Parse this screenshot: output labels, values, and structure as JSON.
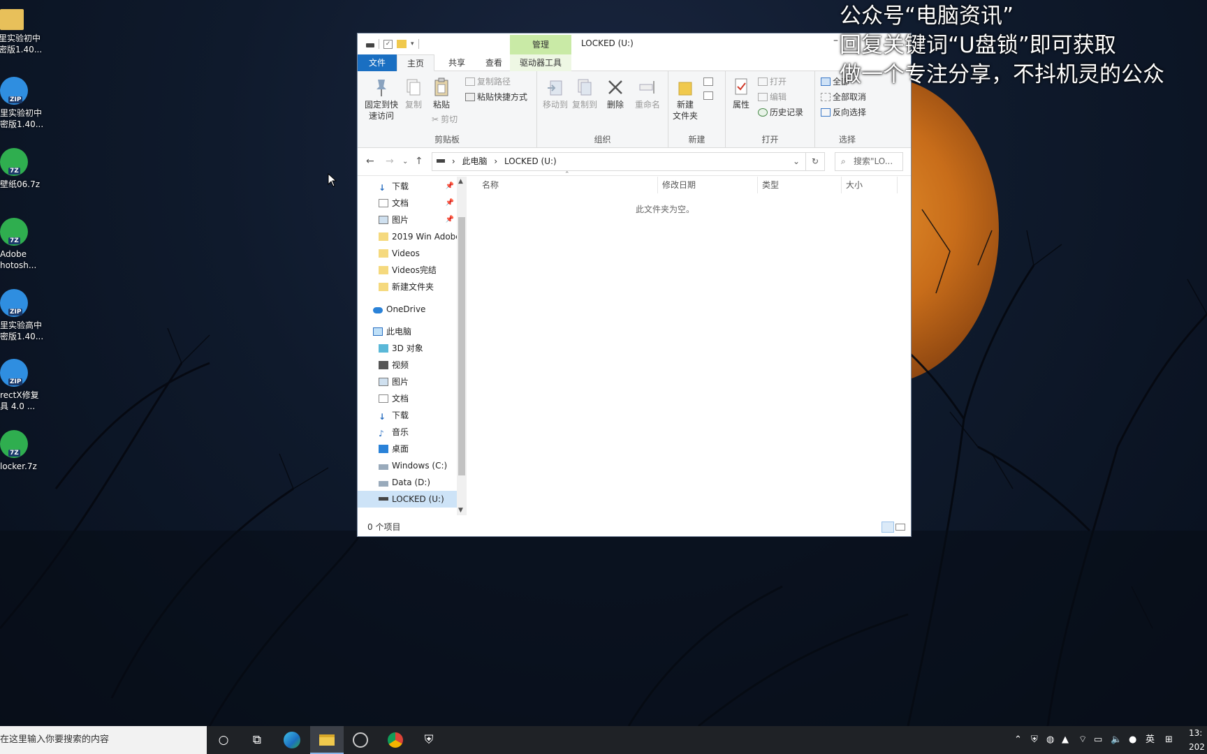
{
  "overlay": {
    "line1": "公众号“电脑资讯”",
    "line2": "回复关键词“U盘锁”即可获取",
    "line3": "做一个专注分享，不抖机灵的公众"
  },
  "desktop_icons": [
    {
      "label1": "里实验初中",
      "label2": "密版1.40...",
      "icon": "folder-icon"
    },
    {
      "label1": "里实验初中",
      "label2": "密版1.40...",
      "icon": "zip-archive-icon",
      "badge": "ZIP"
    },
    {
      "label1": "壁纸06.7z",
      "label2": "",
      "icon": "7z-archive-icon",
      "badge": "7Z"
    },
    {
      "label1": "Adobe",
      "label2": "hotosh...",
      "icon": "7z-archive-icon",
      "badge": "7Z"
    },
    {
      "label1": "里实验高中",
      "label2": "密版1.40...",
      "icon": "zip-archive-icon",
      "badge": "ZIP"
    },
    {
      "label1": "rectX修复",
      "label2": "具 4.0 ...",
      "icon": "zip-archive-icon",
      "badge": "ZIP"
    },
    {
      "label1": "locker.7z",
      "label2": "",
      "icon": "7z-archive-icon",
      "badge": "7Z"
    }
  ],
  "explorer": {
    "title": "LOCKED (U:)",
    "manage_tab": "管理",
    "tabs": {
      "file": "文件",
      "home": "主页",
      "share": "共享",
      "view": "查看",
      "drive_tools": "驱动器工具"
    },
    "ribbon": {
      "clipboard": {
        "name": "剪贴板",
        "pin": "固定到快",
        "pin2": "速访问",
        "copy": "复制",
        "paste": "粘贴",
        "copy_path": "复制路径",
        "paste_shortcut": "粘贴快捷方式",
        "cut": "剪切"
      },
      "organize": {
        "name": "组织",
        "move_to": "移动到",
        "copy_to": "复制到",
        "delete": "删除",
        "rename": "重命名"
      },
      "new": {
        "name": "新建",
        "new_folder": "新建",
        "new_folder2": "文件夹"
      },
      "open": {
        "name": "打开",
        "properties": "属性",
        "open": "打开",
        "edit": "编辑",
        "history": "历史记录"
      },
      "select": {
        "name": "选择",
        "select_all": "全部",
        "select_none": "全部取消",
        "invert": "反向选择"
      }
    },
    "address": {
      "crumb1": "此电脑",
      "crumb2": "LOCKED (U:)",
      "search_placeholder": "搜索\"LO..."
    },
    "nav": [
      {
        "label": "下载",
        "icon": "download-icon",
        "pinned": true
      },
      {
        "label": "文档",
        "icon": "document-icon",
        "pinned": true
      },
      {
        "label": "图片",
        "icon": "pictures-icon",
        "pinned": true
      },
      {
        "label": "2019 Win Adobe",
        "icon": "folder-icon"
      },
      {
        "label": "Videos",
        "icon": "folder-icon"
      },
      {
        "label": "Videos完结",
        "icon": "folder-icon"
      },
      {
        "label": "新建文件夹",
        "icon": "folder-icon"
      },
      {
        "label": "OneDrive",
        "icon": "onedrive-icon"
      },
      {
        "label": "此电脑",
        "icon": "computer-icon"
      },
      {
        "label": "3D 对象",
        "icon": "3d-objects-icon"
      },
      {
        "label": "视频",
        "icon": "video-icon"
      },
      {
        "label": "图片",
        "icon": "pictures-icon"
      },
      {
        "label": "文档",
        "icon": "document-icon"
      },
      {
        "label": "下载",
        "icon": "download-icon"
      },
      {
        "label": "音乐",
        "icon": "music-icon"
      },
      {
        "label": "桌面",
        "icon": "desktop-icon"
      },
      {
        "label": "Windows (C:)",
        "icon": "drive-icon"
      },
      {
        "label": "Data (D:)",
        "icon": "drive-icon"
      },
      {
        "label": "LOCKED (U:)",
        "icon": "usb-drive-icon",
        "selected": true
      }
    ],
    "columns": {
      "name": "名称",
      "modified": "修改日期",
      "type": "类型",
      "size": "大小"
    },
    "empty_message": "此文件夹为空。",
    "status": "0 个项目"
  },
  "taskbar": {
    "search_placeholder": "在这里输入你要搜索的内容",
    "tray_lang": "英",
    "clock_time": "13:",
    "clock_date": "202"
  },
  "colors": {
    "accent": "#1a6fc2",
    "manage_tab": "#c9eaa6",
    "selection": "#cde3f7",
    "moon": "#d07a22",
    "taskbar": "#1f2226"
  }
}
